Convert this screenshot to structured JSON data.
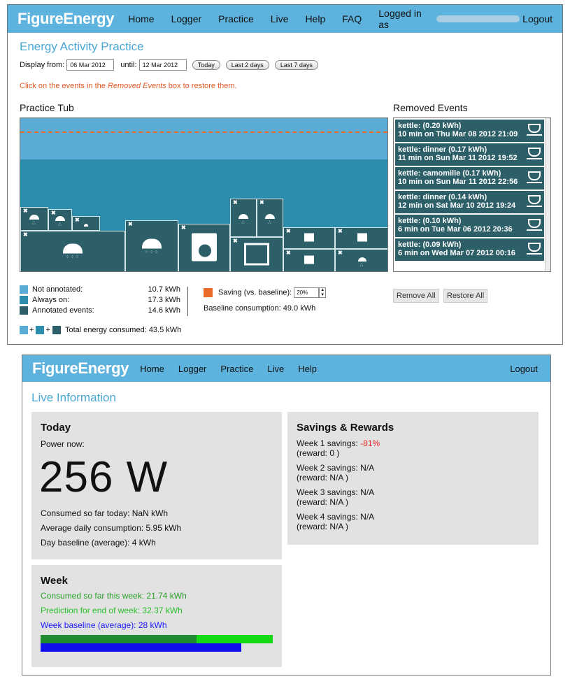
{
  "screen1": {
    "logo": "FigureEnergy",
    "nav": [
      "Home",
      "Logger",
      "Practice",
      "Live",
      "Help",
      "FAQ"
    ],
    "logged_in_label": "Logged in as",
    "logout": "Logout",
    "page_title": "Energy Activity Practice",
    "display_from_label": "Display from:",
    "from_date": "06 Mar 2012",
    "until_label": "until:",
    "until_date": "12 Mar 2012",
    "btn_today": "Today",
    "btn_last2": "Last 2 days",
    "btn_last7": "Last 7 days",
    "notice_pre": "Click on the events in the ",
    "notice_em": "Removed Events",
    "notice_post": " box to restore them.",
    "practice_tub_title": "Practice Tub",
    "removed_events_title": "Removed Events",
    "removed_events": [
      {
        "line1": "kettle: (0.20 kWh)",
        "line2": "10 min on Thu Mar 08 2012 21:09"
      },
      {
        "line1": "kettle: dinner (0.17 kWh)",
        "line2": "11 min on Sun Mar 11 2012 19:52"
      },
      {
        "line1": "kettle: camomille (0.17 kWh)",
        "line2": "10 min on Sun Mar 11 2012 22:56"
      },
      {
        "line1": "kettle: dinner (0.14 kWh)",
        "line2": "12 min on Sat Mar 10 2012 19:24"
      },
      {
        "line1": "kettle: (0.10 kWh)",
        "line2": "6 min on Tue Mar 06 2012 20:36"
      },
      {
        "line1": "kettle: (0.09 kWh)",
        "line2": "6 min on Wed Mar 07 2012 00:16"
      }
    ],
    "legend": {
      "not_annotated_label": "Not annotated:",
      "not_annotated_value": "10.7 kWh",
      "always_on_label": "Always on:",
      "always_on_value": "17.3 kWh",
      "annotated_label": "Annotated events:",
      "annotated_value": "14.6 kWh",
      "total_label": "Total energy consumed: 43.5 kWh",
      "saving_label": "Saving (vs. baseline):",
      "saving_value": "20%",
      "baseline_consumption": "Baseline consumption: 49.0 kWh"
    },
    "btn_remove_all": "Remove All",
    "btn_restore_all": "Restore All",
    "colors": {
      "header": "#5db3dd",
      "not_annotated": "#5aacd7",
      "always_on": "#2d8dac",
      "annotated": "#2c5f68",
      "saving": "#e86b26"
    }
  },
  "screen2": {
    "logo": "FigureEnergy",
    "nav": [
      "Home",
      "Logger",
      "Practice",
      "Live",
      "Help"
    ],
    "logout": "Logout",
    "page_title": "Live Information",
    "today": {
      "title": "Today",
      "power_now_label": "Power now:",
      "power_value": "256 W",
      "consumed_today": "Consumed so far today: NaN kWh",
      "avg_daily": "Average daily consumption: 5.95 kWh",
      "day_baseline": "Day baseline (average): 4 kWh"
    },
    "week": {
      "title": "Week",
      "consumed": "Consumed so far this week: 21.74 kWh",
      "prediction": "Prediction for end of week: 32.37 kWh",
      "baseline": "Week baseline (average): 28 kWh",
      "consumed_kwh": 21.74,
      "prediction_kwh": 32.37,
      "baseline_kwh": 28
    },
    "savings": {
      "title": "Savings & Rewards",
      "weeks": [
        {
          "label": "Week 1 savings: ",
          "value": "-81%",
          "reward": "(reward: 0 )"
        },
        {
          "label": "Week 2 savings: ",
          "value": "N/A",
          "reward": "(reward: N/A )"
        },
        {
          "label": "Week 3 savings: ",
          "value": "N/A",
          "reward": "(reward: N/A )"
        },
        {
          "label": "Week 4 savings: ",
          "value": "N/A",
          "reward": "(reward: N/A )"
        }
      ]
    }
  }
}
